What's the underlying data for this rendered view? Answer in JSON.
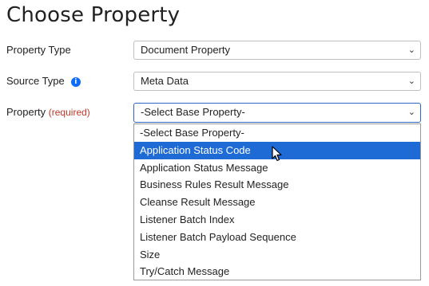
{
  "title": "Choose Property",
  "fields": {
    "property_type": {
      "label": "Property Type",
      "value": "Document Property"
    },
    "source_type": {
      "label": "Source Type",
      "value": "Meta Data",
      "info_icon": "info-icon"
    },
    "property": {
      "label": "Property",
      "required": "(required)",
      "value": "-Select Base Property-"
    }
  },
  "dropdown": {
    "options": [
      "-Select Base Property-",
      "Application Status Code",
      "Application Status Message",
      "Business Rules Result Message",
      "Cleanse Result Message",
      "Listener Batch Index",
      "Listener Batch Payload Sequence",
      "Size",
      "Try/Catch Message"
    ],
    "highlighted": "Application Status Code"
  },
  "colors": {
    "highlight": "#1e6bd6",
    "required": "#c0392b",
    "info": "#0d6efd"
  }
}
